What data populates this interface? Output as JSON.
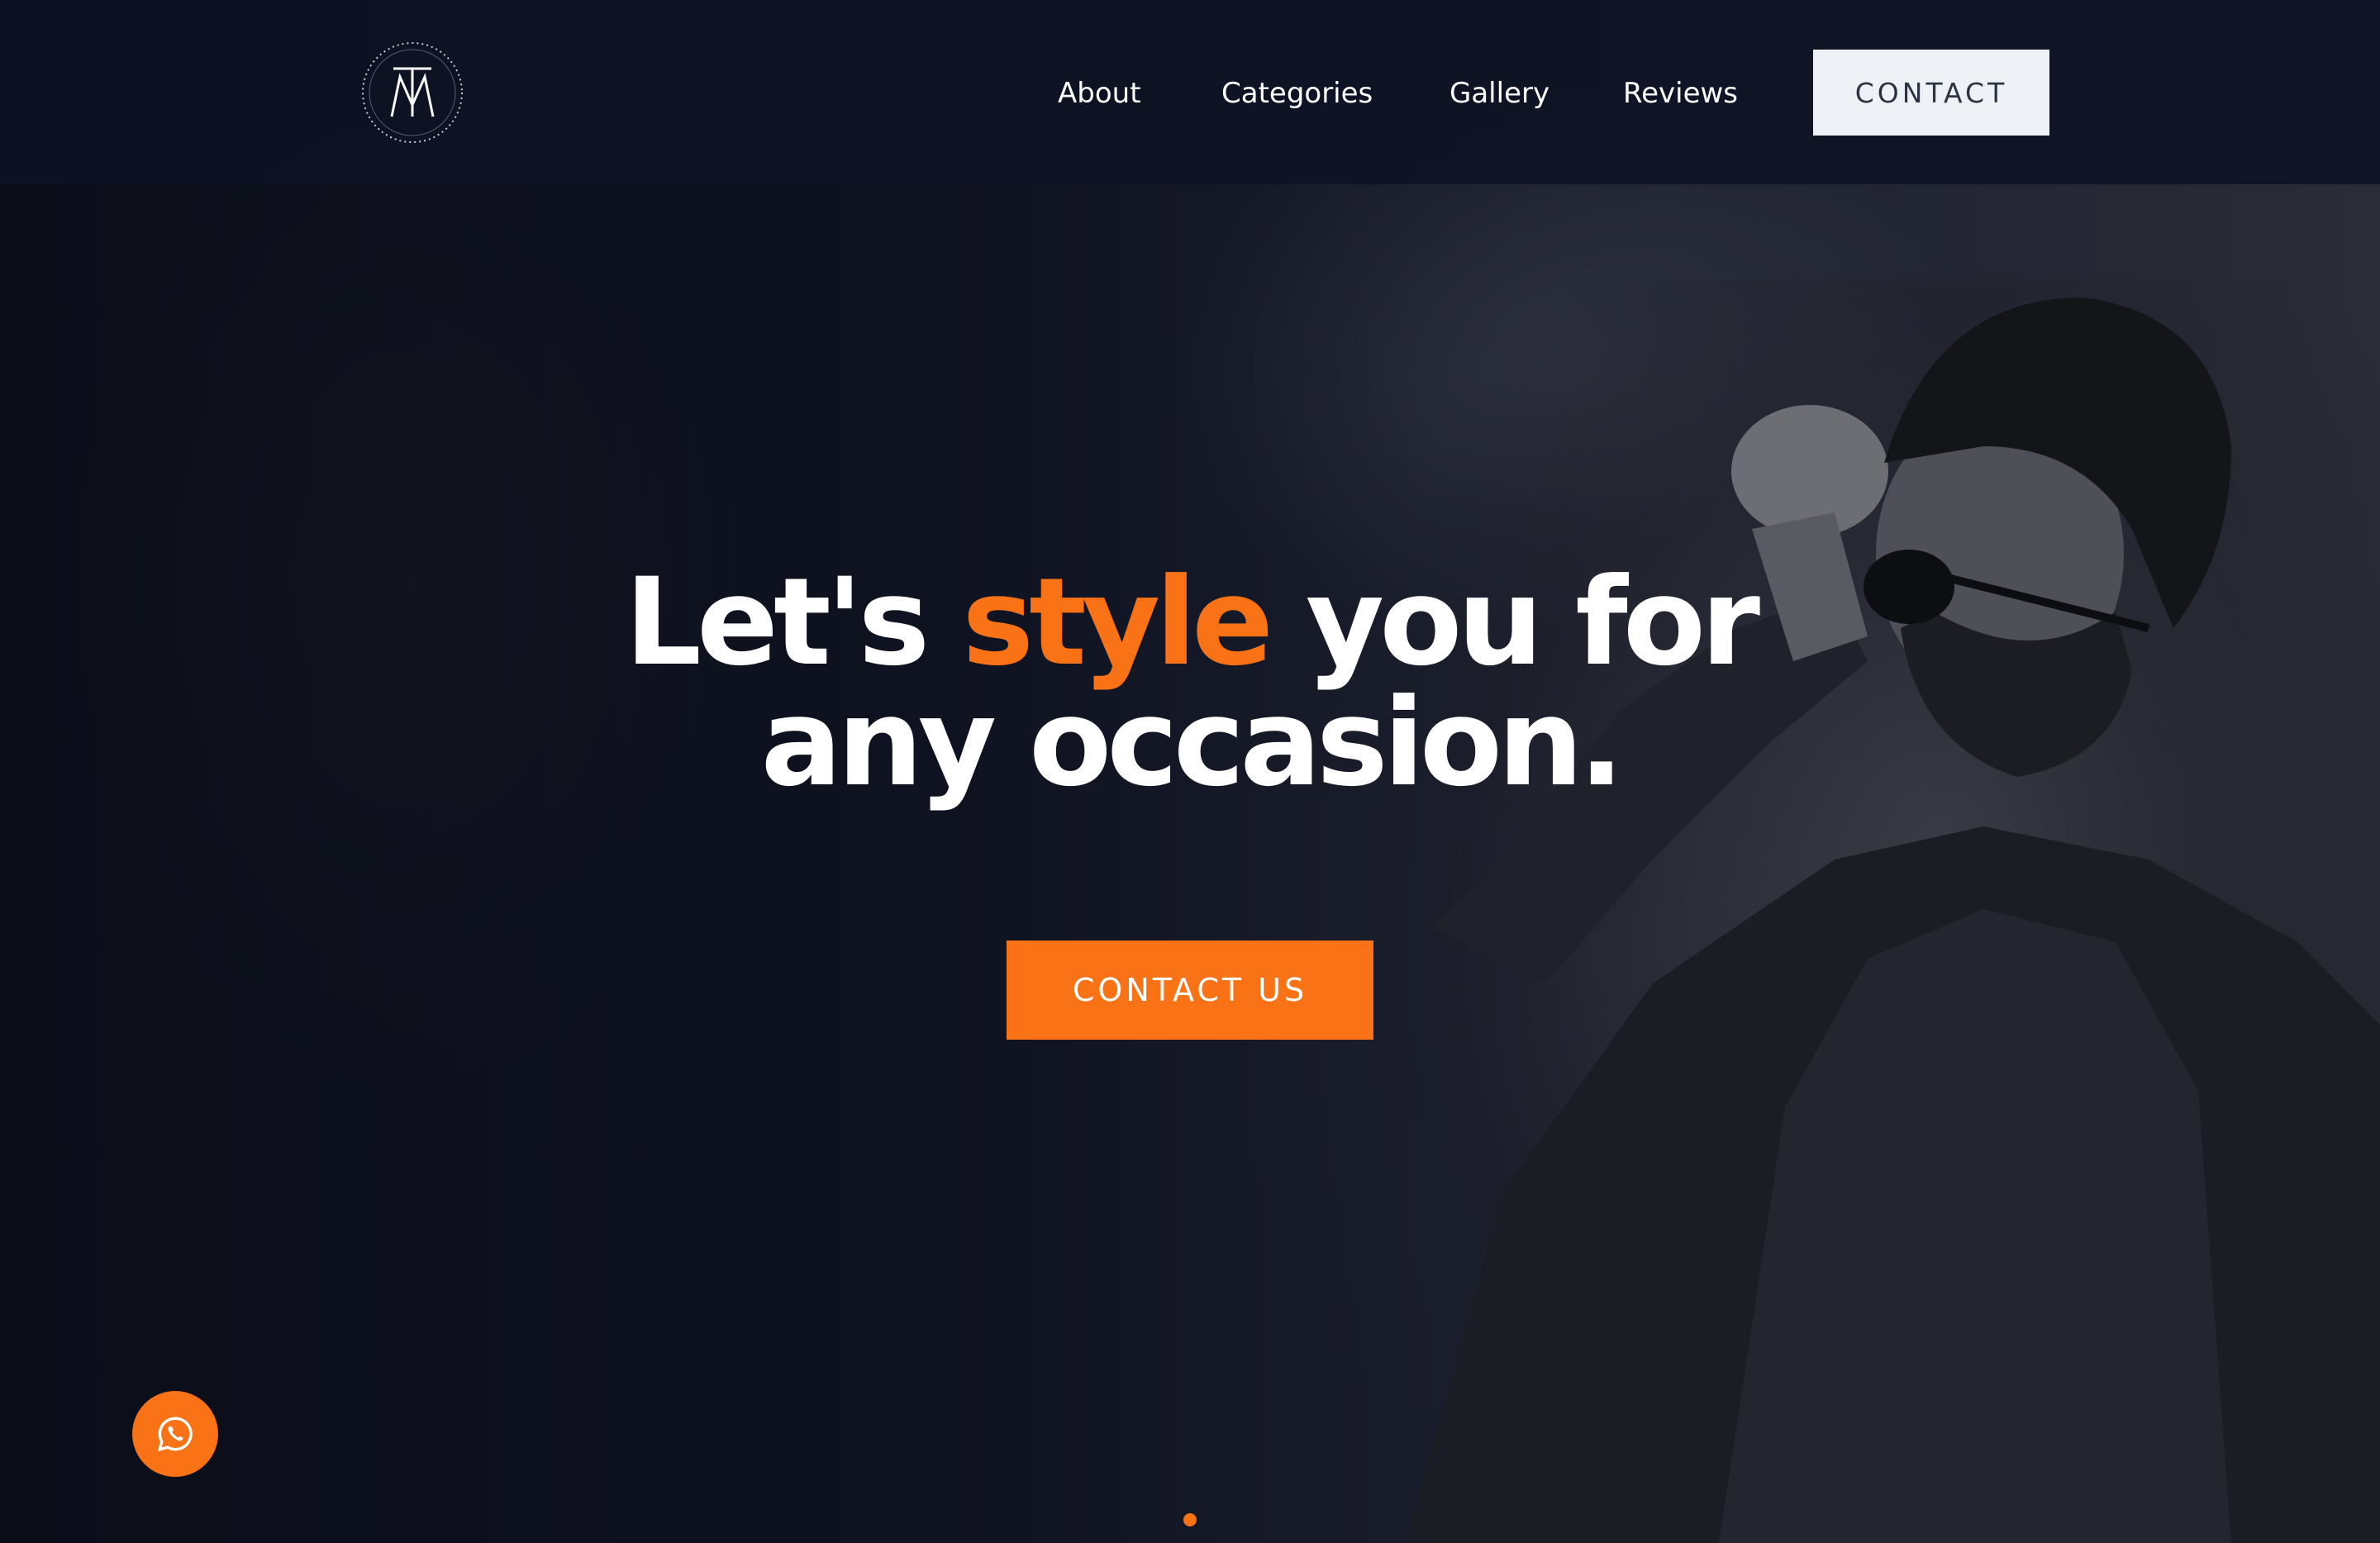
{
  "brand": {
    "logo_letters": "TM",
    "logo_icon": "tm-monogram-logo"
  },
  "nav": {
    "items": [
      {
        "label": "About"
      },
      {
        "label": "Categories"
      },
      {
        "label": "Gallery"
      },
      {
        "label": "Reviews"
      }
    ],
    "contact_label": "CONTACT"
  },
  "hero": {
    "headline_part1": "Let's",
    "headline_accent": "style",
    "headline_part2": "you for",
    "headline_line2": "any occasion.",
    "cta_label": "CONTACT US"
  },
  "floating": {
    "whatsapp_icon": "whatsapp-icon"
  },
  "colors": {
    "accent": "#f97316",
    "nav_bg": "#0e1324",
    "contact_button_bg": "#eef2f7",
    "text": "#ffffff"
  }
}
